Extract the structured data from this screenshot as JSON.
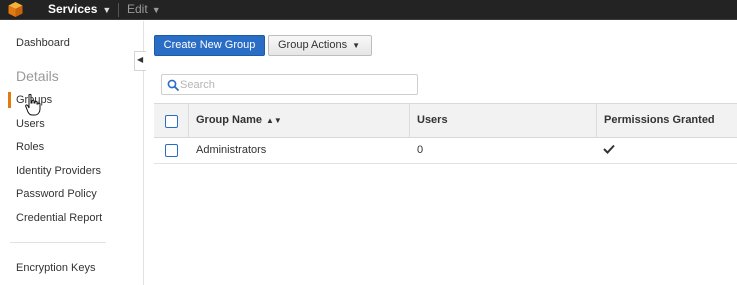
{
  "topbar": {
    "logo_icon": "aws-cube-icon",
    "services_label": "Services",
    "edit_label": "Edit"
  },
  "sidebar": {
    "dashboard": "Dashboard",
    "details_heading": "Details",
    "items": [
      {
        "label": "Groups",
        "active": true
      },
      {
        "label": "Users"
      },
      {
        "label": "Roles"
      },
      {
        "label": "Identity Providers"
      },
      {
        "label": "Password Policy"
      },
      {
        "label": "Credential Report"
      }
    ],
    "encryption_keys": "Encryption Keys",
    "active_color": "#e47911"
  },
  "toolbar": {
    "create_label": "Create New Group",
    "actions_label": "Group Actions",
    "primary_color": "#2a6dc4"
  },
  "search": {
    "placeholder": "Search",
    "value": ""
  },
  "table": {
    "headers": [
      "Group Name",
      "Users",
      "Permissions Granted"
    ],
    "rows": [
      {
        "group_name": "Administrators",
        "users": "0",
        "permissions_granted": true
      }
    ]
  }
}
